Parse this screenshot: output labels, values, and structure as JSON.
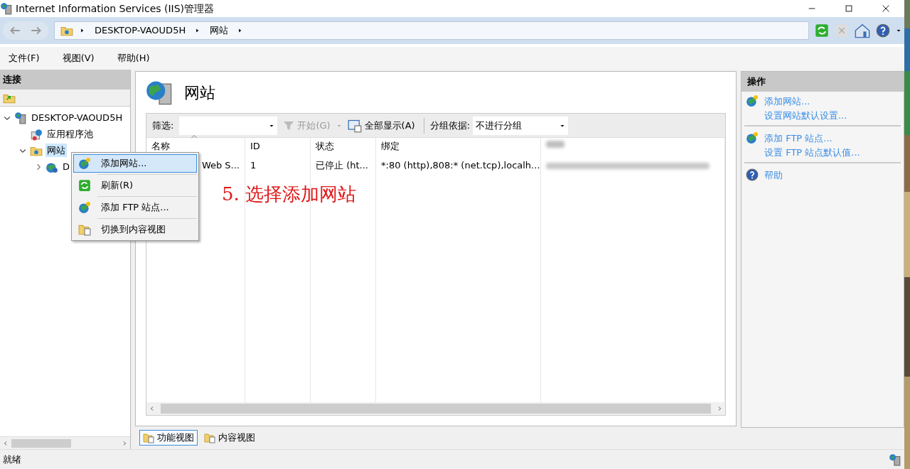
{
  "window": {
    "title": "Internet Information Services (IIS)管理器"
  },
  "address_bar": {
    "segments": [
      "DESKTOP-VAOUD5H",
      "网站"
    ]
  },
  "menu_bar": [
    "文件(F)",
    "视图(V)",
    "帮助(H)"
  ],
  "connections": {
    "title": "连接",
    "tree": [
      {
        "label": "DESKTOP-VAOUD5H",
        "kind": "server",
        "expanded": true,
        "selected": false,
        "children": [
          {
            "label": "应用程序池",
            "kind": "pool",
            "selected": false
          },
          {
            "label": "网站",
            "kind": "folder",
            "expanded": true,
            "selected": true,
            "children": [
              {
                "label": "D",
                "kind": "site",
                "expanded": false,
                "selected": false
              }
            ]
          }
        ]
      }
    ]
  },
  "context_menu": [
    {
      "label": "添加网站...",
      "kind": "add",
      "selected": true
    },
    {
      "label": "刷新(R)",
      "kind": "refresh",
      "selected": false
    },
    {
      "label": "添加 FTP 站点...",
      "kind": "add",
      "selected": false
    },
    {
      "label": "切换到内容视图",
      "kind": "switch",
      "selected": false
    }
  ],
  "content": {
    "title": "网站",
    "filter_bar": {
      "filter_label": "筛选:",
      "start": "开始(G)",
      "show_all": "全部显示(A)",
      "group_label": "分组依据:",
      "group_value": "不进行分组"
    },
    "table": {
      "columns": [
        "名称",
        "ID",
        "状态",
        "绑定"
      ],
      "rows": [
        [
          "Web S...",
          "1",
          "已停止 (ht...",
          "*:80 (http),808:* (net.tcp),localh..."
        ]
      ]
    },
    "view_tabs": [
      {
        "label": "功能视图",
        "selected": true
      },
      {
        "label": "内容视图",
        "selected": false
      }
    ]
  },
  "annotation": "5. 选择添加网站",
  "actions": {
    "title": "操作",
    "groups": [
      {
        "kind": "add",
        "links": [
          "添加网站...",
          "设置网站默认设置..."
        ]
      },
      {
        "kind": "add",
        "links": [
          "添加 FTP 站点...",
          "设置 FTP 站点默认值..."
        ]
      },
      {
        "kind": "help",
        "links": [
          "帮助"
        ]
      }
    ]
  },
  "status_bar": "就绪"
}
